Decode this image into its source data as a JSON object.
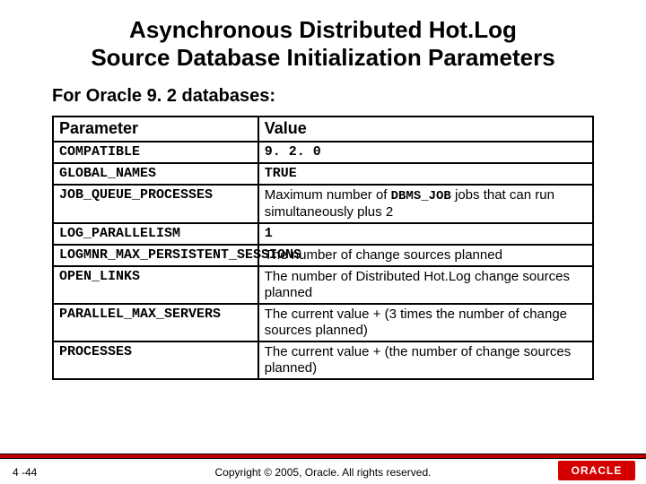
{
  "title_line1": "Asynchronous Distributed Hot.Log",
  "title_line2": "Source Database Initialization Parameters",
  "subhead": "For Oracle 9. 2 databases:",
  "headers": {
    "param": "Parameter",
    "value": "Value"
  },
  "rows": [
    {
      "param": "COMPATIBLE",
      "value_mono": "9. 2. 0"
    },
    {
      "param": "GLOBAL_NAMES",
      "value_mono": "TRUE"
    },
    {
      "param": "JOB_QUEUE_PROCESSES",
      "value_pre": "Maximum number of ",
      "value_mono_inline": "DBMS_JOB",
      "value_post": " jobs that can run simultaneously plus 2"
    },
    {
      "param": "LOG_PARALLELISM",
      "value_mono": "1"
    },
    {
      "param": "LOGMNR_MAX_PERSISTENT_SESSIONS",
      "value_sans": "The number of change sources planned"
    },
    {
      "param": "OPEN_LINKS",
      "value_sans": "The number of Distributed Hot.Log change sources planned"
    },
    {
      "param": "PARALLEL_MAX_SERVERS",
      "value_sans": "The current value + (3 times the number of change sources planned)"
    },
    {
      "param": "PROCESSES",
      "value_sans": "The current value + (the number of change sources planned)"
    }
  ],
  "footer": {
    "page": "4 -44",
    "copyright": "Copyright © 2005, Oracle.  All rights reserved.",
    "logo_text": "ORACLE"
  }
}
